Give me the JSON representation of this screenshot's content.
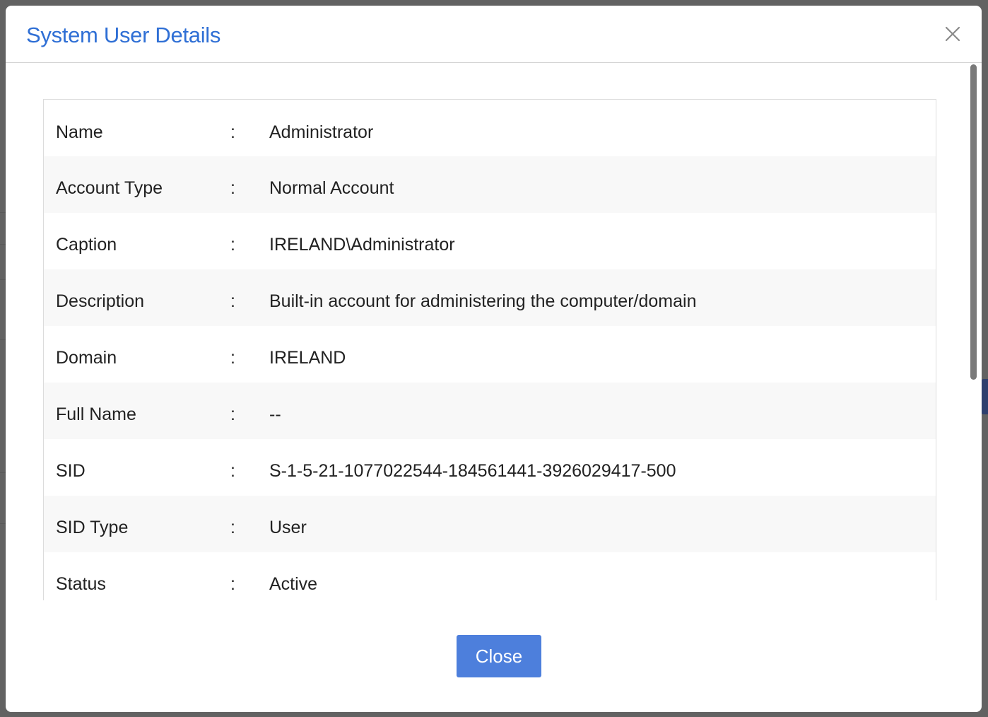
{
  "dialog": {
    "title": "System User Details",
    "close_icon": "close-icon",
    "close_button_label": "Close"
  },
  "details": [
    {
      "label": "Name",
      "separator": ":",
      "value": "Administrator"
    },
    {
      "label": "Account Type",
      "separator": ":",
      "value": "Normal Account"
    },
    {
      "label": "Caption",
      "separator": ":",
      "value": "IRELAND\\Administrator"
    },
    {
      "label": "Description",
      "separator": ":",
      "value": "Built-in account for administering the computer/domain"
    },
    {
      "label": "Domain",
      "separator": ":",
      "value": "IRELAND"
    },
    {
      "label": "Full Name",
      "separator": ":",
      "value": "--"
    },
    {
      "label": "SID",
      "separator": ":",
      "value": "S-1-5-21-1077022544-184561441-3926029417-500"
    },
    {
      "label": "SID Type",
      "separator": ":",
      "value": "User"
    },
    {
      "label": "Status",
      "separator": ":",
      "value": "Active"
    }
  ],
  "colors": {
    "title": "#2f6fd5",
    "primary_button": "#4d7fdc",
    "overlay": "#626262"
  }
}
